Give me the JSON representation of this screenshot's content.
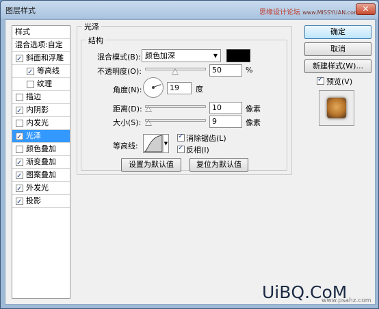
{
  "window": {
    "title": "图层样式",
    "watermark": "思缘设计论坛",
    "watermark_url": "www.MISSYUAN.com",
    "close_label": "✕"
  },
  "styles_list": {
    "header": "样式",
    "blend_options": "混合选项:自定",
    "items": [
      {
        "label": "斜面和浮雕",
        "checked": true
      },
      {
        "label": "等高线",
        "checked": true
      },
      {
        "label": "纹理",
        "checked": false
      },
      {
        "label": "描边",
        "checked": false
      },
      {
        "label": "内阴影",
        "checked": true
      },
      {
        "label": "内发光",
        "checked": false
      },
      {
        "label": "光泽",
        "checked": true
      },
      {
        "label": "颜色叠加",
        "checked": false
      },
      {
        "label": "渐变叠加",
        "checked": true
      },
      {
        "label": "图案叠加",
        "checked": true
      },
      {
        "label": "外发光",
        "checked": true
      },
      {
        "label": "投影",
        "checked": true
      }
    ],
    "selected_index": 6
  },
  "satin": {
    "group_title": "光泽",
    "structure_title": "结构",
    "blend_mode_label": "混合模式(B):",
    "blend_mode_value": "颜色加深",
    "blend_color": "#000000",
    "opacity_label": "不透明度(O):",
    "opacity_value": "50",
    "opacity_unit": "%",
    "angle_label": "角度(N):",
    "angle_value": "19",
    "angle_unit": "度",
    "distance_label": "距离(D):",
    "distance_value": "10",
    "distance_unit": "像素",
    "size_label": "大小(S):",
    "size_value": "9",
    "size_unit": "像素",
    "contour_label": "等高线:",
    "antialias_label": "消除锯齿(L)",
    "antialias_checked": true,
    "invert_label": "反相(I)",
    "invert_checked": true,
    "set_default_label": "设置为默认值",
    "reset_default_label": "复位为默认值"
  },
  "actions": {
    "ok_label": "确定",
    "cancel_label": "取消",
    "new_style_label": "新建样式(W)...",
    "preview_label": "预览(V)",
    "preview_checked": true
  },
  "branding": {
    "logo_text": "UiBQ.CoM",
    "site_url": "www.psahz.com"
  }
}
